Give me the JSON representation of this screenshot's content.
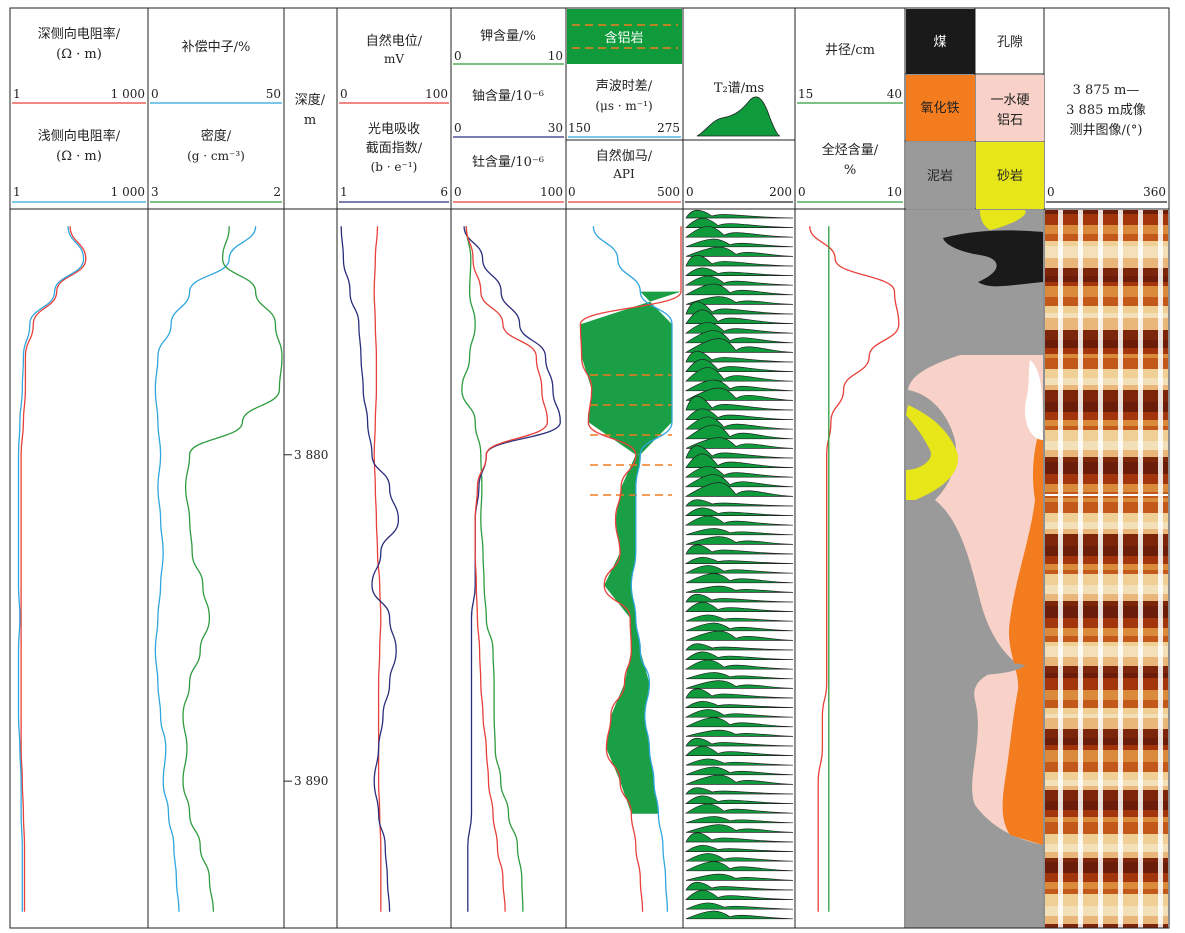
{
  "headers": {
    "res_deep": "深侧向电阻率/",
    "res_unit": "(Ω · m)",
    "res_shallow": "浅侧向电阻率/",
    "res_min": "1",
    "res_max": "1 000",
    "cnl": "补偿中子/%",
    "cnl_min": "0",
    "cnl_max": "50",
    "den": "密度/",
    "den_unit": "(g · cm⁻³)",
    "den_min": "3",
    "den_max": "2",
    "depth": "深度/",
    "depth_unit": "m",
    "sp": "自然电位/",
    "sp_unit": "mV",
    "sp_min": "0",
    "sp_max": "100",
    "pe": "光电吸收",
    "pe2": "截面指数/",
    "pe_unit": "(b · e⁻¹)",
    "pe_min": "1",
    "pe_max": "6",
    "k": "钾含量/%",
    "k_min": "0",
    "k_max": "10",
    "u": "铀含量/10⁻⁶",
    "u_min": "0",
    "u_max": "30",
    "th": "钍含量/10⁻⁶",
    "th_min": "0",
    "th_max": "100",
    "al_legend": "含铝岩",
    "ac": "声波时差/",
    "ac_unit": "(μs · m⁻¹)",
    "ac_min": "150",
    "ac_max": "275",
    "gr": "自然伽马/",
    "gr_unit": "API",
    "gr_min": "0",
    "gr_max": "500",
    "t2": "T₂谱/ms",
    "t2_min": "0",
    "t2_max": "200",
    "cal": "井径/cm",
    "cal_min": "15",
    "cal_max": "40",
    "tg": "全烃含量/",
    "tg_unit": "%",
    "tg_min": "0",
    "tg_max": "10",
    "lith_coal": "煤",
    "lith_pore": "孔隙",
    "lith_fe": "氧化铁",
    "lith_boeh1": "一水硬",
    "lith_boeh2": "铝石",
    "lith_mud": "泥岩",
    "lith_sand": "砂岩",
    "img1": "3 875 m—",
    "img2": "3 885 m成像",
    "img3": "测井图像/(°)",
    "img_min": "0",
    "img_max": "360"
  },
  "colors": {
    "red": "#e8403a",
    "blue": "#2fa6de",
    "green": "#2e9c3e",
    "navy": "#2a2e7c",
    "fill_green": "#0f9a3c",
    "orange": "#f27c1e",
    "pink": "#f8d2c8",
    "gray": "#9a9a9a",
    "yellow": "#e6e619",
    "coal": "#1a1a1a"
  },
  "chart_data": {
    "type": "line",
    "title": "",
    "y_axis": "深度/m",
    "ylim": [
      3872.5,
      3894.5
    ],
    "depth_ticks": [
      "3 880",
      "3 890"
    ],
    "depth_tick_values": [
      3880,
      3890
    ],
    "depth": [
      3873,
      3874,
      3875,
      3876,
      3877,
      3878,
      3879,
      3880,
      3881,
      3882,
      3883,
      3884,
      3885,
      3886,
      3887,
      3888,
      3889,
      3890,
      3891,
      3892,
      3893,
      3894
    ],
    "series": [
      {
        "name": "深侧向电阻率",
        "color": "red",
        "xlim": [
          1,
          1000
        ],
        "scale": "log",
        "values": [
          20,
          45,
          10,
          3,
          2,
          2,
          1.8,
          1.6,
          1.6,
          1.6,
          1.6,
          1.6,
          1.6,
          1.6,
          1.6,
          1.6,
          1.6,
          1.7,
          1.8,
          1.9,
          1.9,
          1.9
        ]
      },
      {
        "name": "浅侧向电阻率",
        "color": "blue",
        "xlim": [
          1,
          1000
        ],
        "scale": "log",
        "values": [
          18,
          40,
          9,
          2.5,
          1.8,
          1.7,
          1.5,
          1.4,
          1.4,
          1.4,
          1.4,
          1.4,
          1.5,
          1.4,
          1.4,
          1.4,
          1.5,
          1.6,
          1.6,
          1.7,
          1.7,
          1.7
        ]
      },
      {
        "name": "补偿中子",
        "color": "blue",
        "xlim": [
          0,
          50
        ],
        "values": [
          40,
          30,
          15,
          8,
          3,
          2,
          3,
          4,
          3,
          4,
          5,
          4,
          3,
          2,
          3,
          4,
          6,
          5,
          7,
          9,
          10,
          11
        ]
      },
      {
        "name": "密度",
        "color": "green",
        "xlim": [
          3,
          2
        ],
        "values": [
          2.4,
          2.45,
          2.2,
          2.05,
          2.0,
          2.02,
          2.3,
          2.7,
          2.73,
          2.7,
          2.68,
          2.6,
          2.55,
          2.62,
          2.7,
          2.75,
          2.72,
          2.75,
          2.7,
          2.62,
          2.55,
          2.52
        ]
      },
      {
        "name": "自然电位",
        "color": "red",
        "xlim": [
          0,
          100
        ],
        "values": [
          35,
          33,
          32,
          33,
          34,
          34,
          33,
          32,
          33,
          34,
          35,
          37,
          38,
          37,
          36,
          36,
          36,
          36,
          37,
          38,
          38,
          38
        ]
      },
      {
        "name": "光电吸收截面指数",
        "color": "navy",
        "xlim": [
          1,
          6
        ],
        "values": [
          1.1,
          1.2,
          1.5,
          1.9,
          2.0,
          2.1,
          2.3,
          2.5,
          3.3,
          3.7,
          2.9,
          2.5,
          3.3,
          3.6,
          3.3,
          3.0,
          2.8,
          2.6,
          2.8,
          3.1,
          3.2,
          3.3
        ]
      },
      {
        "name": "钾含量",
        "color": "green",
        "xlim": [
          0,
          10
        ],
        "values": [
          1.2,
          1.6,
          1.5,
          2.0,
          1.5,
          0.8,
          2.0,
          2.5,
          2.6,
          2.5,
          2.7,
          2.8,
          3.0,
          3.6,
          3.7,
          3.7,
          3.8,
          4.3,
          5.0,
          5.8,
          6.2,
          6.3
        ]
      },
      {
        "name": "铀含量",
        "color": "navy",
        "xlim": [
          0,
          30
        ],
        "values": [
          3,
          8,
          13,
          18,
          25,
          27,
          29,
          9,
          7,
          6,
          6,
          6,
          5,
          5,
          5,
          5,
          5,
          5,
          5,
          4,
          4,
          4
        ]
      },
      {
        "name": "钍含量",
        "color": "red",
        "xlim": [
          0,
          100
        ],
        "values": [
          12,
          18,
          25,
          45,
          75,
          80,
          85,
          30,
          22,
          20,
          20,
          21,
          22,
          24,
          25,
          27,
          30,
          32,
          36,
          40,
          45,
          47
        ]
      },
      {
        "name": "声波时差",
        "color": "blue",
        "xlim": [
          150,
          275
        ],
        "values": [
          178,
          205,
          230,
          265,
          265,
          265,
          265,
          230,
          225,
          225,
          225,
          220,
          225,
          230,
          240,
          235,
          240,
          245,
          250,
          255,
          258,
          260
        ]
      },
      {
        "name": "自然伽马",
        "color": "red",
        "xlim": [
          0,
          500
        ],
        "values": [
          500,
          500,
          500,
          55,
          60,
          105,
          90,
          300,
          235,
          210,
          230,
          160,
          275,
          280,
          250,
          190,
          170,
          230,
          280,
          300,
          320,
          330
        ]
      },
      {
        "name": "井径",
        "color": "red",
        "xlim": [
          15,
          40
        ],
        "values": [
          18,
          24,
          38,
          39,
          32,
          26,
          23,
          22,
          22,
          22,
          22,
          22,
          22,
          22,
          22,
          21,
          21,
          20,
          20,
          20,
          20,
          20
        ]
      },
      {
        "name": "全烃含量",
        "color": "green",
        "xlim": [
          0,
          10
        ],
        "values": [
          3,
          3,
          3,
          3,
          3,
          3,
          3,
          3,
          3,
          3,
          3,
          3,
          3,
          3,
          3,
          3,
          3,
          3,
          3,
          3,
          3,
          3
        ]
      }
    ]
  }
}
